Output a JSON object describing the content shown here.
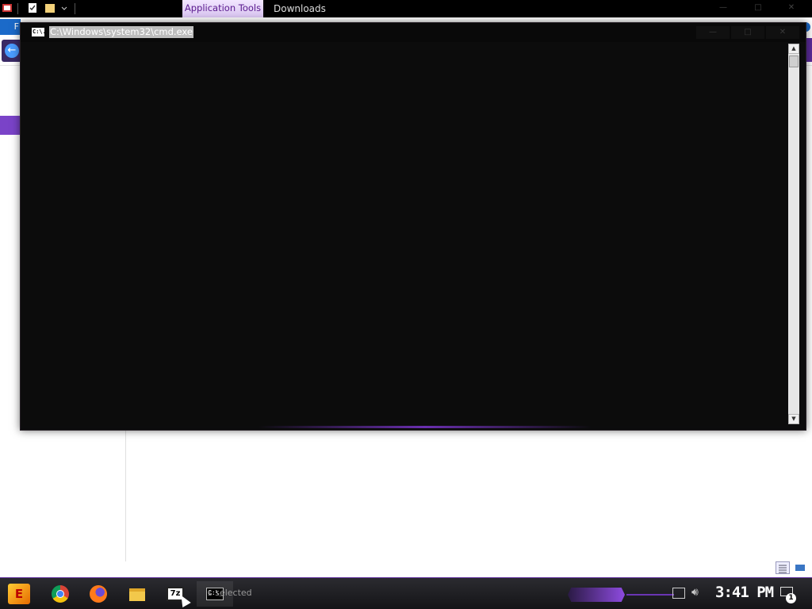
{
  "explorer": {
    "contextual_tab": "Application Tools",
    "window_title": "Downloads",
    "file_tab": "F",
    "status_bar_text": "s selected"
  },
  "cmd": {
    "title": "C:\\Windows\\system32\\cmd.exe",
    "icon_text": "C:\\.",
    "minimize_glyph": "—",
    "maximize_glyph": "□",
    "close_glyph": "✕"
  },
  "taskbar": {
    "start_text": "E",
    "sevenzip_text": "7z",
    "cmd_icon_text": "C:\\_",
    "clock": "3:41 PM",
    "notification_count": "1"
  },
  "icons": {
    "start": "start-icon",
    "chrome": "chrome-icon",
    "firefox": "firefox-icon",
    "file_explorer": "folder-icon",
    "sevenzip": "7zip-icon",
    "cmd": "terminal-icon",
    "network": "network-icon",
    "volume": "volume-icon",
    "notification": "notification-icon"
  },
  "colors": {
    "accent_purple": "#7a43c8",
    "console_bg": "#0c0c0c",
    "file_tab_blue": "#1b6ac9"
  }
}
